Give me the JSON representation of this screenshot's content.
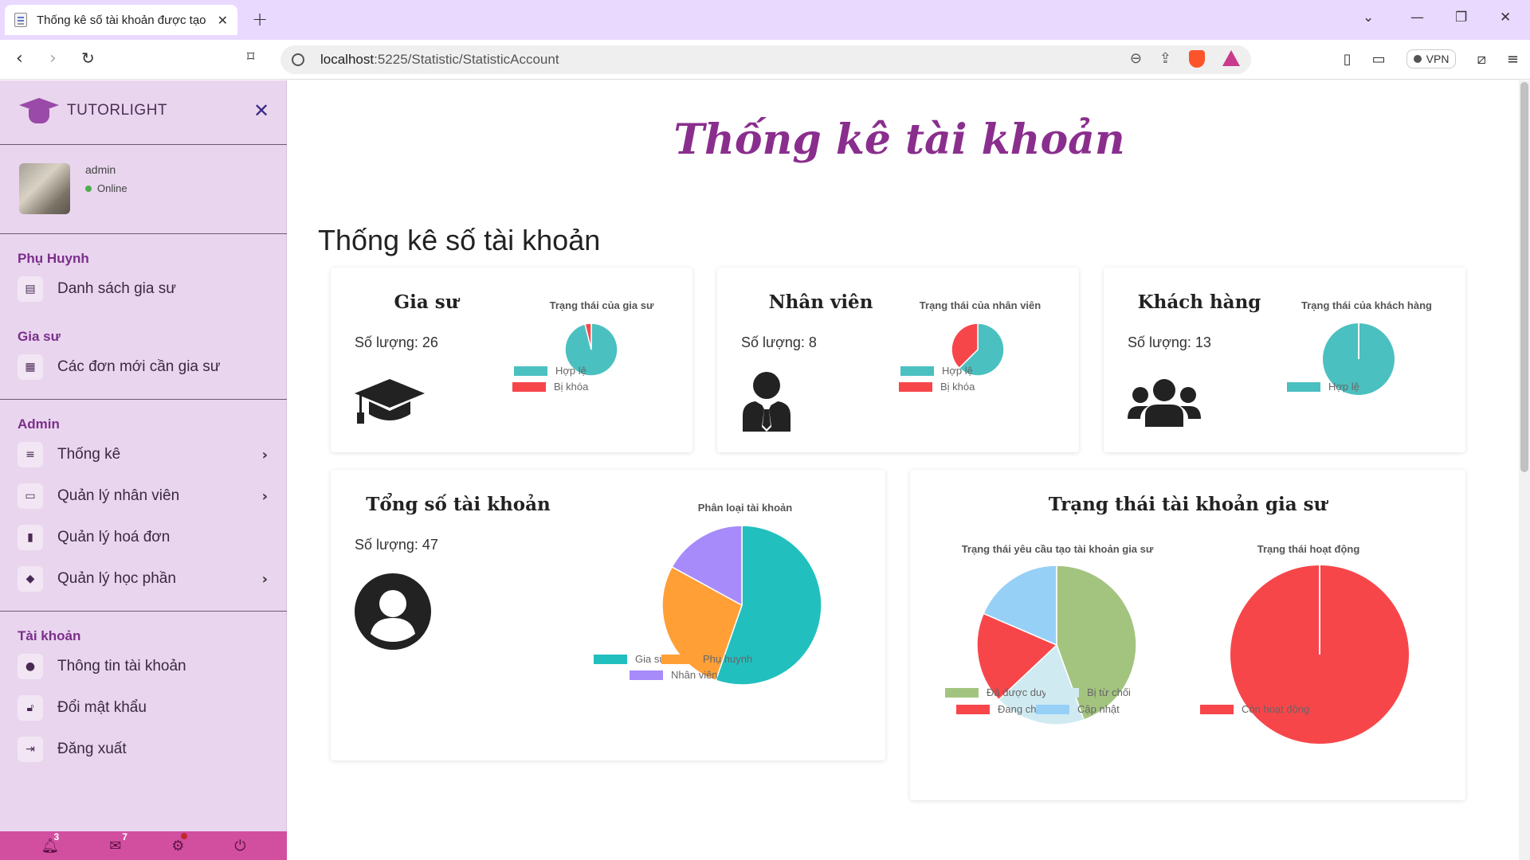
{
  "browser": {
    "tab_title": "Thống kê số tài khoản được tạo",
    "url_host": "localhost",
    "url_path": ":5225/Statistic/StatisticAccount",
    "vpn_label": "VPN"
  },
  "sidebar": {
    "brand": "TUTORLIGHT",
    "user": {
      "name": "admin",
      "status": "Online"
    },
    "sections": {
      "parent": "Phụ Huynh",
      "tutor": "Gia sư",
      "admin": "Admin",
      "account": "Tài khoản"
    },
    "items": {
      "tutor_list": "Danh sách gia sư",
      "new_orders": "Các đơn mới cần gia sư",
      "statistics": "Thống kê",
      "staff_mgmt": "Quản lý nhân viên",
      "invoice_mgmt": "Quản lý hoá đơn",
      "course_mgmt": "Quản lý học phần",
      "account_info": "Thông tin tài khoản",
      "change_password": "Đổi mật khẩu",
      "logout": "Đăng xuất"
    },
    "bottom": {
      "notifications": "3",
      "messages": "7"
    }
  },
  "main": {
    "page_title": "Thống kê tài khoản",
    "section_title": "Thống kê số tài khoản",
    "tutor_card": {
      "title": "Gia sư",
      "count": "Số lượng: 26"
    },
    "staff_card": {
      "title": "Nhân viên",
      "count": "Số lượng: 8"
    },
    "customer_card": {
      "title": "Khách hàng",
      "count": "Số lượng: 13"
    },
    "total_card": {
      "title": "Tổng số tài khoản",
      "count": "Số lượng: 47"
    },
    "tutor_status_card": {
      "title": "Trạng thái tài khoản gia sư"
    }
  },
  "colors": {
    "teal": "#4bc0c0",
    "red": "#f7464a",
    "orange": "#ff9f40",
    "purple": "#a78bfa",
    "green": "#a3c47f",
    "lightblue": "#d0eaf1",
    "skyblue": "#97d0f7",
    "accent": "#8a2e8e"
  },
  "chart_data": [
    {
      "type": "pie",
      "title": "Trạng thái của gia sư",
      "categories": [
        "Hợp lệ",
        "Bị khóa"
      ],
      "values": [
        25,
        1
      ],
      "colors": [
        "#4bc0c0",
        "#f7464a"
      ]
    },
    {
      "type": "pie",
      "title": "Trạng thái của nhân viên",
      "categories": [
        "Hợp lệ",
        "Bị khóa"
      ],
      "values": [
        5,
        3
      ],
      "colors": [
        "#4bc0c0",
        "#f7464a"
      ]
    },
    {
      "type": "pie",
      "title": "Trạng thái của khách hàng",
      "categories": [
        "Hợp lệ"
      ],
      "values": [
        13
      ],
      "colors": [
        "#4bc0c0"
      ]
    },
    {
      "type": "pie",
      "title": "Phân loại tài khoản",
      "categories": [
        "Gia sư",
        "Phụ huynh",
        "Nhân viên"
      ],
      "values": [
        26,
        13,
        8
      ],
      "colors": [
        "#22bfbf",
        "#ff9f36",
        "#a78bfa"
      ]
    },
    {
      "type": "pie",
      "title": "Trạng thái yêu cầu tạo tài khoản gia sư",
      "categories": [
        "Đã được duyệt",
        "Bị từ chối",
        "Đang chờ",
        "Cập nhật"
      ],
      "values": [
        12,
        5,
        5,
        5
      ],
      "colors": [
        "#a3c47f",
        "#d0eaf1",
        "#f7464a",
        "#97d0f7"
      ]
    },
    {
      "type": "pie",
      "title": "Trạng thái hoạt động",
      "categories": [
        "Còn hoạt động"
      ],
      "values": [
        26
      ],
      "colors": [
        "#f7464a"
      ]
    }
  ]
}
